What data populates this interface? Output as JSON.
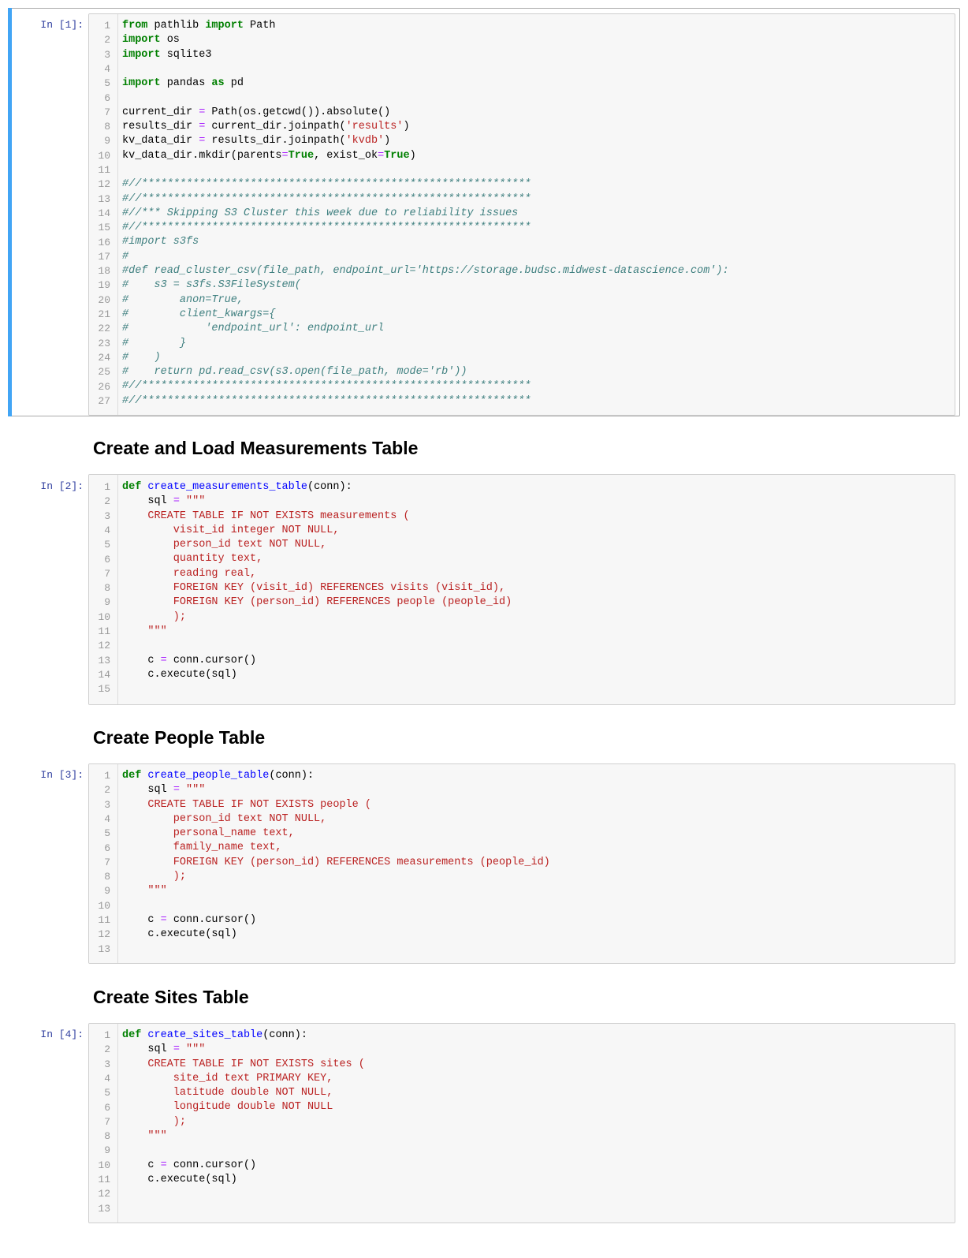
{
  "cells": [
    {
      "prompt": "In [1]:",
      "lines": [
        [
          [
            "kw",
            "from"
          ],
          [
            "t",
            " pathlib "
          ],
          [
            "kw",
            "import"
          ],
          [
            "t",
            " Path"
          ]
        ],
        [
          [
            "kw",
            "import"
          ],
          [
            "t",
            " os"
          ]
        ],
        [
          [
            "kw",
            "import"
          ],
          [
            "t",
            " sqlite3"
          ]
        ],
        [],
        [
          [
            "kw",
            "import"
          ],
          [
            "t",
            " pandas "
          ],
          [
            "kw",
            "as"
          ],
          [
            "t",
            " pd"
          ]
        ],
        [],
        [
          [
            "t",
            "current_dir "
          ],
          [
            "op",
            "="
          ],
          [
            "t",
            " Path(os.getcwd()).absolute()"
          ]
        ],
        [
          [
            "t",
            "results_dir "
          ],
          [
            "op",
            "="
          ],
          [
            "t",
            " current_dir.joinpath("
          ],
          [
            "str",
            "'results'"
          ],
          [
            "t",
            ")"
          ]
        ],
        [
          [
            "t",
            "kv_data_dir "
          ],
          [
            "op",
            "="
          ],
          [
            "t",
            " results_dir.joinpath("
          ],
          [
            "str",
            "'kvdb'"
          ],
          [
            "t",
            ")"
          ]
        ],
        [
          [
            "t",
            "kv_data_dir.mkdir(parents"
          ],
          [
            "op",
            "="
          ],
          [
            "kw",
            "True"
          ],
          [
            "t",
            ", exist_ok"
          ],
          [
            "op",
            "="
          ],
          [
            "kw",
            "True"
          ],
          [
            "t",
            ")"
          ]
        ],
        [],
        [
          [
            "cm",
            "#//*************************************************************"
          ]
        ],
        [
          [
            "cm",
            "#//*************************************************************"
          ]
        ],
        [
          [
            "cm",
            "#//*** Skipping S3 Cluster this week due to reliability issues"
          ]
        ],
        [
          [
            "cm",
            "#//*************************************************************"
          ]
        ],
        [
          [
            "cm",
            "#import s3fs"
          ]
        ],
        [
          [
            "cm",
            "#"
          ]
        ],
        [
          [
            "cm",
            "#def read_cluster_csv(file_path, endpoint_url='https://storage.budsc.midwest-datascience.com'):"
          ]
        ],
        [
          [
            "cm",
            "#    s3 = s3fs.S3FileSystem("
          ]
        ],
        [
          [
            "cm",
            "#        anon=True,"
          ]
        ],
        [
          [
            "cm",
            "#        client_kwargs={"
          ]
        ],
        [
          [
            "cm",
            "#            'endpoint_url': endpoint_url"
          ]
        ],
        [
          [
            "cm",
            "#        }"
          ]
        ],
        [
          [
            "cm",
            "#    )"
          ]
        ],
        [
          [
            "cm",
            "#    return pd.read_csv(s3.open(file_path, mode='rb'))"
          ]
        ],
        [
          [
            "cm",
            "#//*************************************************************"
          ]
        ],
        [
          [
            "cm",
            "#//*************************************************************"
          ]
        ]
      ]
    },
    {
      "heading": "Create and Load Measurements Table",
      "prompt": "In [2]:",
      "lines": [
        [
          [
            "kw",
            "def"
          ],
          [
            "t",
            " "
          ],
          [
            "def",
            "create_measurements_table"
          ],
          [
            "t",
            "(conn):"
          ]
        ],
        [
          [
            "t",
            "    sql "
          ],
          [
            "op",
            "="
          ],
          [
            "t",
            " "
          ],
          [
            "str",
            "\"\"\""
          ]
        ],
        [
          [
            "str",
            "    CREATE TABLE IF NOT EXISTS measurements ("
          ]
        ],
        [
          [
            "str",
            "        visit_id integer NOT NULL,"
          ]
        ],
        [
          [
            "str",
            "        person_id text NOT NULL,"
          ]
        ],
        [
          [
            "str",
            "        quantity text,"
          ]
        ],
        [
          [
            "str",
            "        reading real,"
          ]
        ],
        [
          [
            "str",
            "        FOREIGN KEY (visit_id) REFERENCES visits (visit_id),"
          ]
        ],
        [
          [
            "str",
            "        FOREIGN KEY (person_id) REFERENCES people (people_id)"
          ]
        ],
        [
          [
            "str",
            "        );"
          ]
        ],
        [
          [
            "str",
            "    \"\"\""
          ]
        ],
        [],
        [
          [
            "t",
            "    c "
          ],
          [
            "op",
            "="
          ],
          [
            "t",
            " conn.cursor()"
          ]
        ],
        [
          [
            "t",
            "    c.execute(sql)"
          ]
        ],
        []
      ]
    },
    {
      "heading": "Create People Table",
      "prompt": "In [3]:",
      "lines": [
        [
          [
            "kw",
            "def"
          ],
          [
            "t",
            " "
          ],
          [
            "def",
            "create_people_table"
          ],
          [
            "t",
            "(conn):"
          ]
        ],
        [
          [
            "t",
            "    sql "
          ],
          [
            "op",
            "="
          ],
          [
            "t",
            " "
          ],
          [
            "str",
            "\"\"\""
          ]
        ],
        [
          [
            "str",
            "    CREATE TABLE IF NOT EXISTS people ("
          ]
        ],
        [
          [
            "str",
            "        person_id text NOT NULL,"
          ]
        ],
        [
          [
            "str",
            "        personal_name text,"
          ]
        ],
        [
          [
            "str",
            "        family_name text,"
          ]
        ],
        [
          [
            "str",
            "        FOREIGN KEY (person_id) REFERENCES measurements (people_id)"
          ]
        ],
        [
          [
            "str",
            "        );"
          ]
        ],
        [
          [
            "str",
            "    \"\"\""
          ]
        ],
        [],
        [
          [
            "t",
            "    c "
          ],
          [
            "op",
            "="
          ],
          [
            "t",
            " conn.cursor()"
          ]
        ],
        [
          [
            "t",
            "    c.execute(sql)"
          ]
        ],
        []
      ]
    },
    {
      "heading": "Create Sites Table",
      "prompt": "In [4]:",
      "lines": [
        [
          [
            "kw",
            "def"
          ],
          [
            "t",
            " "
          ],
          [
            "def",
            "create_sites_table"
          ],
          [
            "t",
            "(conn):"
          ]
        ],
        [
          [
            "t",
            "    sql "
          ],
          [
            "op",
            "="
          ],
          [
            "t",
            " "
          ],
          [
            "str",
            "\"\"\""
          ]
        ],
        [
          [
            "str",
            "    CREATE TABLE IF NOT EXISTS sites ("
          ]
        ],
        [
          [
            "str",
            "        site_id text PRIMARY KEY,"
          ]
        ],
        [
          [
            "str",
            "        latitude double NOT NULL,"
          ]
        ],
        [
          [
            "str",
            "        longitude double NOT NULL"
          ]
        ],
        [
          [
            "str",
            "        );"
          ]
        ],
        [
          [
            "str",
            "    \"\"\""
          ]
        ],
        [],
        [
          [
            "t",
            "    c "
          ],
          [
            "op",
            "="
          ],
          [
            "t",
            " conn.cursor()"
          ]
        ],
        [
          [
            "t",
            "    c.execute(sql)"
          ]
        ],
        [],
        []
      ]
    }
  ]
}
